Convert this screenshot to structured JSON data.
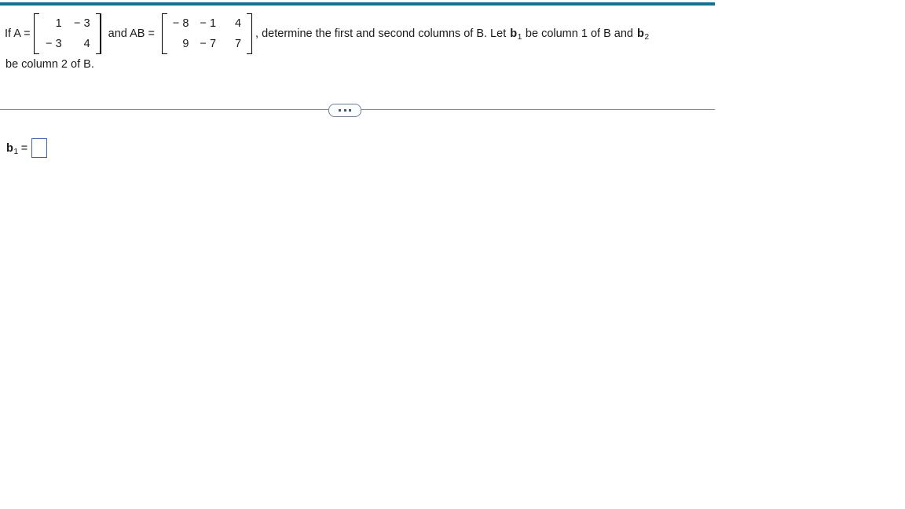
{
  "theme": {
    "accent_bar_color": "#0f7391",
    "divider_color": "#7c8aa5",
    "input_border_color": "#3f63ad",
    "text_color": "#1a1a1a"
  },
  "problem": {
    "intro": "If A =",
    "connector": "and AB =",
    "tail_part1": ", determine the first and second columns of B. Let",
    "tail_part2": "be column 1 of B and",
    "line2": "be column 2 of B.",
    "matrix_a": {
      "name": "A",
      "rows": 2,
      "cols": 2,
      "values": [
        [
          "1",
          "− 3"
        ],
        [
          "− 3",
          "4"
        ]
      ]
    },
    "matrix_ab": {
      "name": "AB",
      "rows": 2,
      "cols": 3,
      "values": [
        [
          "− 8",
          "− 1",
          "4"
        ],
        [
          "9",
          "− 7",
          "7"
        ]
      ]
    },
    "vector_b1": {
      "symbol": "b",
      "subscript": "1"
    },
    "vector_b2": {
      "symbol": "b",
      "subscript": "2"
    }
  },
  "divider": {
    "more_options_label": "•••"
  },
  "answer": {
    "label_symbol": "b",
    "label_subscript": "1",
    "equals": "=",
    "value": "",
    "placeholder": ""
  }
}
